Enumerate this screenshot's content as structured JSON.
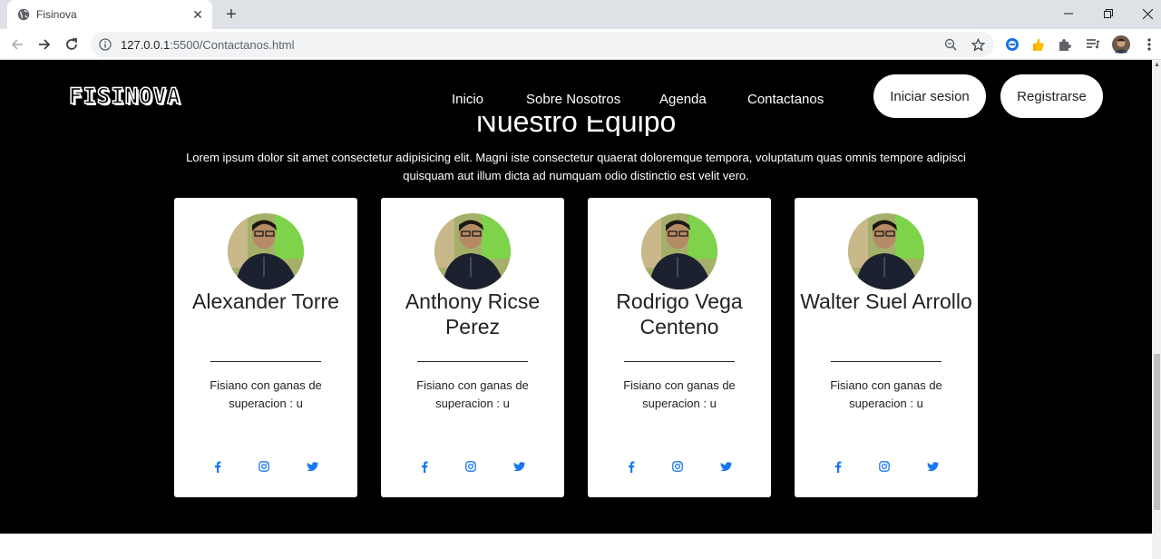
{
  "browser": {
    "tab_title": "Fisinova",
    "url_host": "127.0.0.1",
    "url_path": ":5500/Contactanos.html"
  },
  "header": {
    "logo_text": "FISINOVA",
    "nav": [
      "Inicio",
      "Sobre Nosotros",
      "Agenda",
      "Contactanos"
    ],
    "login_label": "Iniciar sesion",
    "register_label": "Registrarse"
  },
  "section": {
    "title": "Nuestro Equipo",
    "intro": "Lorem ipsum dolor sit amet consectetur adipisicing elit. Magni iste consectetur quaerat doloremque tempora, voluptatum quas omnis tempore adipisci quisquam aut illum dicta ad numquam odio distinctio est velit vero."
  },
  "team": [
    {
      "name": "Alexander Torre",
      "description": "Fisiano con ganas de superacion : u"
    },
    {
      "name": "Anthony Ricse Perez",
      "description": "Fisiano con ganas de superacion : u"
    },
    {
      "name": "Rodrigo Vega Centeno",
      "description": "Fisiano con ganas de superacion : u"
    },
    {
      "name": "Walter Suel Arrollo",
      "description": "Fisiano con ganas de superacion : u"
    }
  ],
  "colors": {
    "background": "#000000",
    "card": "#ffffff",
    "social_icon": "#1877f2"
  },
  "icons": [
    "facebook-icon",
    "instagram-icon",
    "twitter-icon"
  ]
}
